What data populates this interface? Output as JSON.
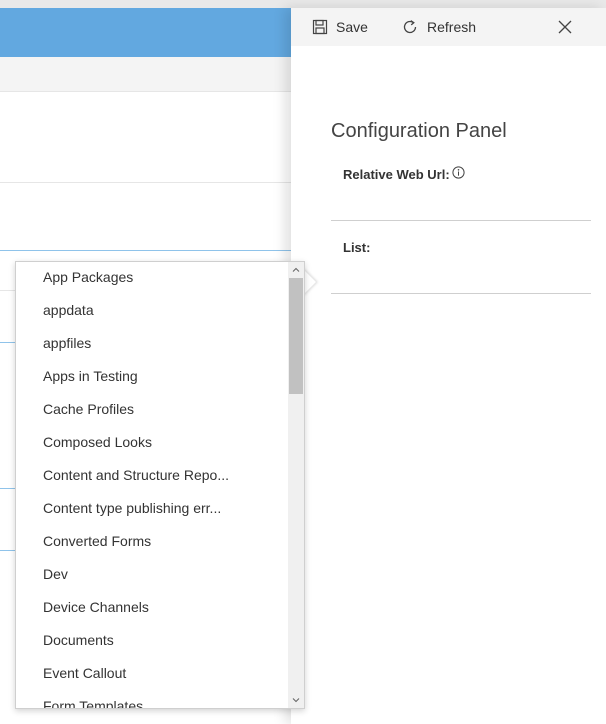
{
  "toolbar": {
    "save_label": "Save",
    "refresh_label": "Refresh"
  },
  "panel": {
    "title": "Configuration Panel",
    "fields": {
      "relative_web_url_label": "Relative Web Url:",
      "list_label": "List:"
    }
  },
  "dropdown": {
    "items": [
      "App Packages",
      "appdata",
      "appfiles",
      "Apps in Testing",
      "Cache Profiles",
      "Composed Looks",
      "Content and Structure Repo...",
      "Content type publishing err...",
      "Converted Forms",
      "Dev",
      "Device Channels",
      "Documents",
      "Event Callout",
      "Form Templates"
    ]
  },
  "colors": {
    "header_blue": "#62a8e0",
    "toolbar_bg": "#f4f4f4",
    "scroll_thumb": "#c1c1c1"
  },
  "icons": {
    "save": "save-icon",
    "refresh": "refresh-icon",
    "close": "close-icon",
    "info": "info-icon"
  }
}
